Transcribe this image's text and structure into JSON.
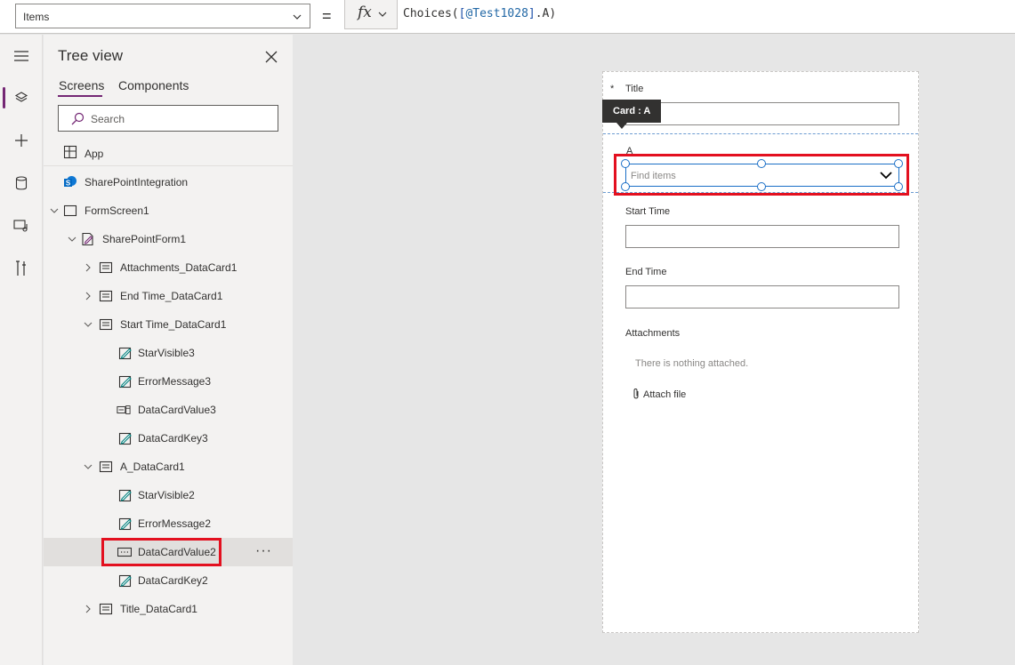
{
  "formula_bar": {
    "property": "Items",
    "equals": "=",
    "fx": "fx",
    "formula_prefix": "Choices(",
    "formula_open": "[",
    "formula_ref": "@Test1028",
    "formula_close": "]",
    "formula_suffix": ".A)"
  },
  "rail": {
    "items": [
      "hamburger-icon",
      "layers-icon",
      "plus-icon",
      "database-icon",
      "media-icon",
      "tools-icon"
    ]
  },
  "tree": {
    "title": "Tree view",
    "tabs": [
      "Screens",
      "Components"
    ],
    "search_placeholder": "Search",
    "app_label": "App",
    "rows": [
      {
        "label": "SharePointIntegration"
      },
      {
        "label": "FormScreen1"
      },
      {
        "label": "SharePointForm1"
      },
      {
        "label": "Attachments_DataCard1"
      },
      {
        "label": "End Time_DataCard1"
      },
      {
        "label": "Start Time_DataCard1"
      },
      {
        "label": "StarVisible3"
      },
      {
        "label": "ErrorMessage3"
      },
      {
        "label": "DataCardValue3"
      },
      {
        "label": "DataCardKey3"
      },
      {
        "label": "A_DataCard1"
      },
      {
        "label": "StarVisible2"
      },
      {
        "label": "ErrorMessage2"
      },
      {
        "label": "DataCardValue2"
      },
      {
        "label": "DataCardKey2"
      },
      {
        "label": "Title_DataCard1"
      }
    ],
    "more": "···"
  },
  "form": {
    "tooltip": "Card : A",
    "star": "*",
    "title_label": "Title",
    "a_label": "A",
    "combo_placeholder": "Find items",
    "start_label": "Start Time",
    "end_label": "End Time",
    "attachments_label": "Attachments",
    "nothing_attached": "There is nothing attached.",
    "attach_file": "Attach file"
  },
  "colors": {
    "accent": "#742774",
    "highlight": "#e3101f",
    "selection_blue": "#1b6fc7"
  }
}
